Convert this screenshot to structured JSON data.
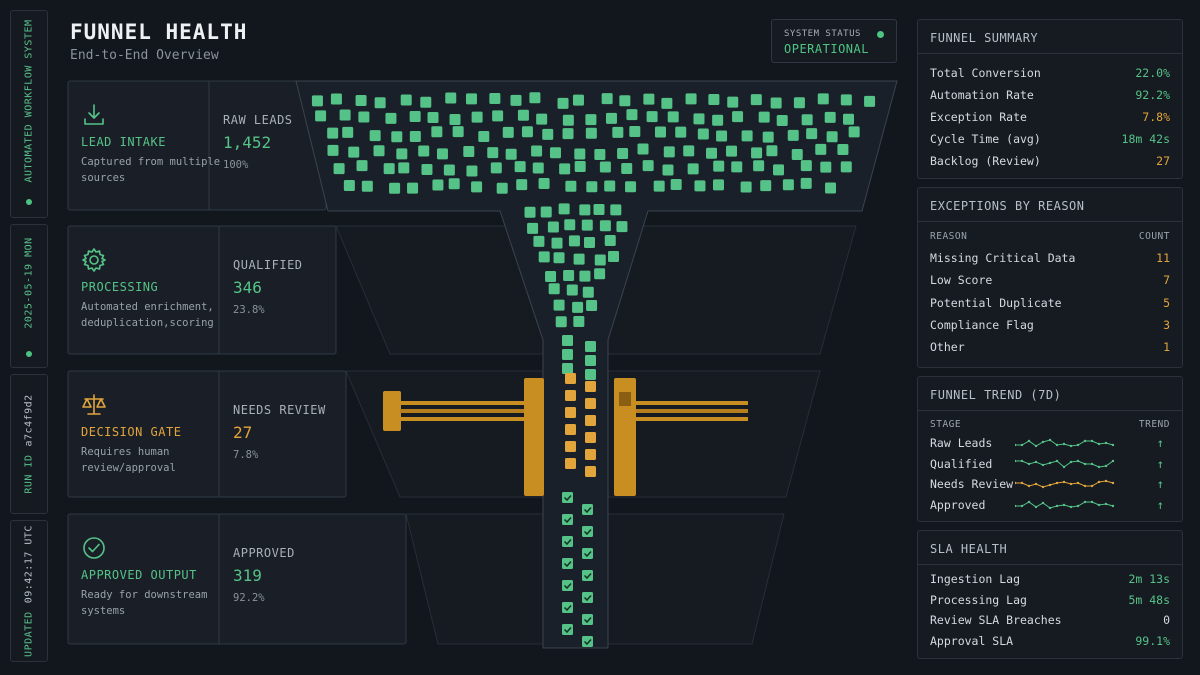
{
  "strip": {
    "system_label": "AUTOMATED WORKFLOW SYSTEM",
    "date": "2025-05-19 MON",
    "run_label": "RUN ID",
    "run_id": "a7c4f9d2",
    "updated_label": "UPDATED",
    "updated_time": "09:42:17 UTC"
  },
  "header": {
    "title": "FUNNEL HEALTH",
    "subtitle": "End-to-End Overview",
    "status_label": "SYSTEM STATUS",
    "status_value": "OPERATIONAL"
  },
  "stages": [
    {
      "icon": "download-icon",
      "title": "LEAD INTAKE",
      "desc": "Captured from multiple sources",
      "metric_label": "RAW LEADS",
      "value": "1,452",
      "pct": "100%",
      "color": "#55c387"
    },
    {
      "icon": "gear-icon",
      "title": "PROCESSING",
      "desc": "Automated enrichment, deduplication,scoring",
      "metric_label": "QUALIFIED",
      "value": "346",
      "pct": "23.8%",
      "color": "#55c387"
    },
    {
      "icon": "scales-icon",
      "title": "DECISION GATE",
      "desc": "Requires human review/approval",
      "metric_label": "NEEDS REVIEW",
      "value": "27",
      "pct": "7.8%",
      "color": "#e2a53b"
    },
    {
      "icon": "check-circle-icon",
      "title": "APPROVED OUTPUT",
      "desc": "Ready for downstream systems",
      "metric_label": "APPROVED",
      "value": "319",
      "pct": "92.2%",
      "color": "#55c387"
    }
  ],
  "summary": {
    "title": "FUNNEL SUMMARY",
    "rows": [
      {
        "label": "Total Conversion",
        "value": "22.0%",
        "color": "#55c387"
      },
      {
        "label": "Automation Rate",
        "value": "92.2%",
        "color": "#55c387"
      },
      {
        "label": "Exception Rate",
        "value": "7.8%",
        "color": "#e2a53b"
      },
      {
        "label": "Cycle Time (avg)",
        "value": "18m 42s",
        "color": "#55c387"
      },
      {
        "label": "Backlog (Review)",
        "value": "27",
        "color": "#e2a53b"
      }
    ]
  },
  "exceptions": {
    "title": "EXCEPTIONS BY REASON",
    "col_reason": "REASON",
    "col_count": "COUNT",
    "rows": [
      {
        "label": "Missing Critical Data",
        "value": "11"
      },
      {
        "label": "Low Score",
        "value": "7"
      },
      {
        "label": "Potential Duplicate",
        "value": "5"
      },
      {
        "label": "Compliance Flag",
        "value": "3"
      },
      {
        "label": "Other",
        "value": "1"
      }
    ]
  },
  "trend": {
    "title": "FUNNEL TREND (7D)",
    "col_stage": "STAGE",
    "col_trend": "TREND",
    "rows": [
      {
        "label": "Raw Leads",
        "color": "#55c387",
        "arrow": "↑"
      },
      {
        "label": "Qualified",
        "color": "#55c387",
        "arrow": "↑"
      },
      {
        "label": "Needs Review",
        "color": "#e2a53b",
        "arrow": "↑"
      },
      {
        "label": "Approved",
        "color": "#55c387",
        "arrow": "↑"
      }
    ]
  },
  "sla": {
    "title": "SLA HEALTH",
    "rows": [
      {
        "label": "Ingestion Lag",
        "value": "2m 13s",
        "color": "#55c387"
      },
      {
        "label": "Processing Lag",
        "value": "5m 48s",
        "color": "#55c387"
      },
      {
        "label": "Review SLA Breaches",
        "value": "0",
        "color": "#d4dae0"
      },
      {
        "label": "Approval SLA",
        "value": "99.1%",
        "color": "#55c387"
      }
    ]
  },
  "colors": {
    "green": "#55c387",
    "amber": "#e2a53b",
    "gate": "#c98e22"
  }
}
